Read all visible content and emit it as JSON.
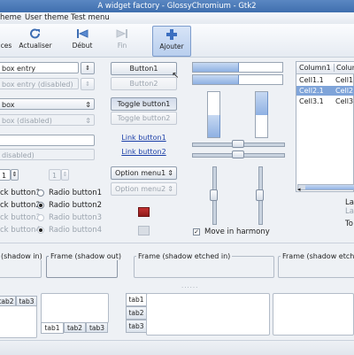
{
  "window": {
    "title": "A widget factory - GlossyChromium - Gtk2"
  },
  "menu": {
    "items": [
      "heme",
      "User theme",
      "Test menu"
    ]
  },
  "toolbar": {
    "items": [
      {
        "label": "ces",
        "icon": "refresh-icon"
      },
      {
        "label": "Actualiser",
        "icon": "refresh-icon"
      },
      {
        "label": "Début",
        "icon": "go-first-icon"
      },
      {
        "label": "Fin",
        "icon": "go-last-icon"
      },
      {
        "label": "Ajouter",
        "icon": "plus-icon"
      }
    ]
  },
  "left": {
    "combo_entry_value": "box entry",
    "combo_entry_dis_value": "box entry (disabled)",
    "combo_value": "box",
    "combo_dis_value": "box (disabled)",
    "entry_value": "",
    "entry_dis_value": "disabled)",
    "spin_value": "1",
    "spin_dis_value": "1",
    "check_labels": [
      "ck button1",
      "ck button2",
      "ck button3",
      "ck button4"
    ],
    "radio_labels": [
      "Radio button1",
      "Radio button2",
      "Radio button3",
      "Radio button4"
    ]
  },
  "middle": {
    "button1": "Button1",
    "button2": "Button2",
    "toggle1": "Toggle button1",
    "toggle2": "Toggle button2",
    "link1": "Link button1",
    "link2": "Link button2",
    "option1": "Option menu1",
    "option2": "Option menu2"
  },
  "sliders": {
    "hbar1_fraction": 0.5,
    "hbar2_fraction": 0.5,
    "vbar1_fraction": 0.5,
    "vbar2_fraction": 0.5,
    "hscale1": 0.5,
    "hscale2": 0.5,
    "vscale1": 0.5,
    "vscale2": 0.5,
    "harmony_label": "Move in harmony"
  },
  "tree": {
    "columns": [
      "Column1",
      "Column"
    ],
    "rows": [
      [
        "Cell1.1",
        "Cell1"
      ],
      [
        "Cell2.1",
        "Cell2"
      ],
      [
        "Cell3.1",
        "Cell3"
      ]
    ],
    "selected_row": 1
  },
  "right_labels": [
    "La",
    "La",
    "To"
  ],
  "frames": [
    "(shadow in)",
    "Frame (shadow out)",
    "Frame (shadow etched in)",
    "Frame (shadow etche"
  ],
  "tabs": {
    "group1": [
      "tab2",
      "tab3"
    ],
    "group2": [
      "tab1",
      "tab2",
      "tab3"
    ],
    "group3": [
      "tab1",
      "tab2",
      "tab3"
    ]
  },
  "colors": {
    "title_bar": "#4a7bbb",
    "selection": "#7fa4d9",
    "accent": "#3c6fc0"
  }
}
